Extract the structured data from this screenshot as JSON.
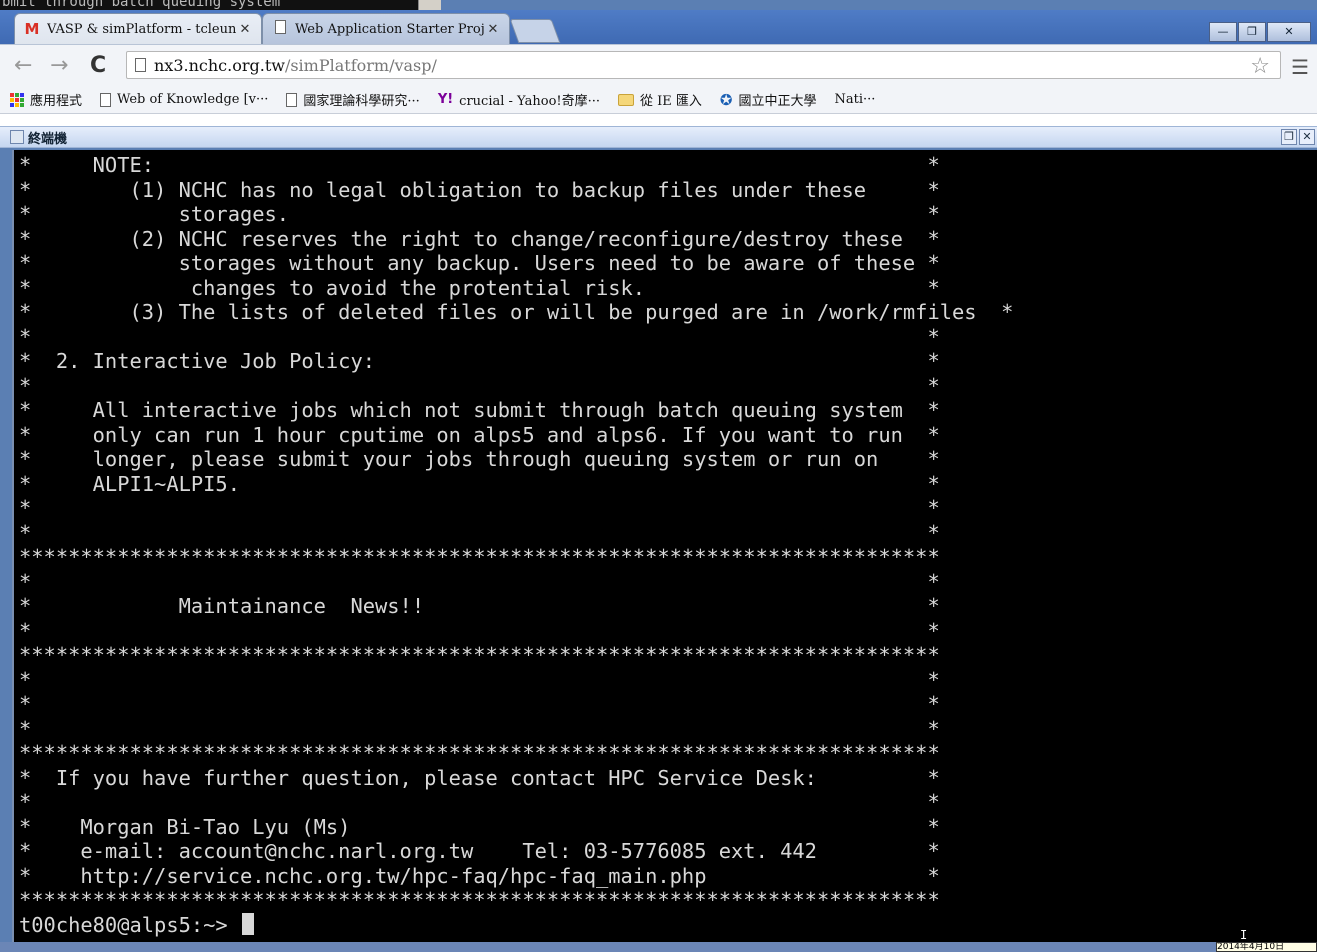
{
  "background_terminal_text": "bmit through batch queuing system",
  "tabs": [
    {
      "title": "VASP & simPlatform - tcleun",
      "favicon": "gmail-icon",
      "active": true
    },
    {
      "title": "Web Application Starter Proje",
      "favicon": "page-icon",
      "active": false
    }
  ],
  "window_buttons": {
    "minimize": "—",
    "restore": "❐",
    "close": "✕"
  },
  "address_bar": {
    "host": "nx3.nchc.org.tw",
    "path": "/simPlatform/vasp/"
  },
  "bookmarks": [
    {
      "label": "應用程式",
      "icon": "apps-grid-icon"
    },
    {
      "label": "Web of Knowledge [v···",
      "icon": "page-icon"
    },
    {
      "label": "國家理論科學研究···",
      "icon": "page-icon"
    },
    {
      "label": "crucial - Yahoo!奇摩···",
      "icon": "yahoo-icon"
    },
    {
      "label": "從 IE 匯入",
      "icon": "folder-icon"
    },
    {
      "label": "國立中正大學",
      "icon": "ccu-logo-icon"
    },
    {
      "label": "Nati···",
      "icon": ""
    }
  ],
  "panel": {
    "title": "終端機"
  },
  "terminal": {
    "lines": [
      "*     NOTE:                                                               *",
      "*        (1) NCHC has no legal obligation to backup files under these     *",
      "*            storages.                                                    *",
      "*        (2) NCHC reserves the right to change/reconfigure/destroy these  *",
      "*            storages without any backup. Users need to be aware of these *",
      "*             changes to avoid the protential risk.                       *",
      "*        (3) The lists of deleted files or will be purged are in /work/rmfiles  *",
      "*                                                                         *",
      "*  2. Interactive Job Policy:                                             *",
      "*                                                                         *",
      "*     All interactive jobs which not submit through batch queuing system  *",
      "*     only can run 1 hour cputime on alps5 and alps6. If you want to run  *",
      "*     longer, please submit your jobs through queuing system or run on    *",
      "*     ALPI1~ALPI5.                                                        *",
      "*                                                                         *",
      "*                                                                         *",
      "***************************************************************************",
      "*                                                                         *",
      "*            Maintainance  News!!                                         *",
      "*                                                                         *",
      "***************************************************************************",
      "*                                                                         *",
      "*                                                                         *",
      "*                                                                         *",
      "***************************************************************************",
      "*  If you have further question, please contact HPC Service Desk:         *",
      "*                                                                         *",
      "*    Morgan Bi-Tao Lyu (Ms)                                               *",
      "*    e-mail: account@nchc.narl.org.tw    Tel: 03-5776085 ext. 442         *",
      "*    http://service.nchc.org.tw/hpc-faq/hpc-faq_main.php                  *",
      "***************************************************************************"
    ],
    "prompt": "t00che80@alps5:~> "
  },
  "taskbar": {
    "clock": "2014年4月10日"
  }
}
